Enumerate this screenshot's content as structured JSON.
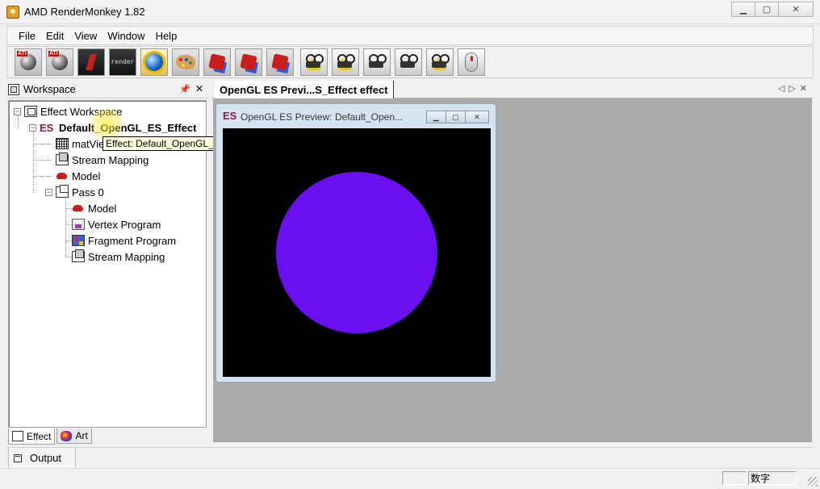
{
  "window": {
    "title": "AMD RenderMonkey 1.82"
  },
  "menu": {
    "items": [
      {
        "label": "File"
      },
      {
        "label": "Edit"
      },
      {
        "label": "View"
      },
      {
        "label": "Window"
      },
      {
        "label": "Help"
      }
    ]
  },
  "toolbar": {
    "render_label": "render"
  },
  "workspace": {
    "title": "Workspace",
    "tree": {
      "root": "Effect Workspace",
      "effect": "Default_OpenGL_ES_Effect",
      "matrix": "matView",
      "stream_mapping": "Stream Mapping",
      "model": "Model",
      "pass": "Pass 0",
      "pass_model": "Model",
      "vertex_program": "Vertex Program",
      "fragment_program": "Fragment Program",
      "pass_stream_mapping": "Stream Mapping"
    },
    "tooltip": "Effect: Default_OpenGL_ES_Effect",
    "tabs": [
      {
        "label": "Effect"
      },
      {
        "label": "Art"
      }
    ]
  },
  "document": {
    "tab_label": "OpenGL ES Previ...S_Effect effect",
    "preview_title": "OpenGL ES Preview: Default_Open...",
    "sphere_color": "#6a0ff0",
    "viewport_bg": "#000000"
  },
  "output": {
    "label": "Output"
  },
  "status": {
    "numlock": "数字"
  }
}
